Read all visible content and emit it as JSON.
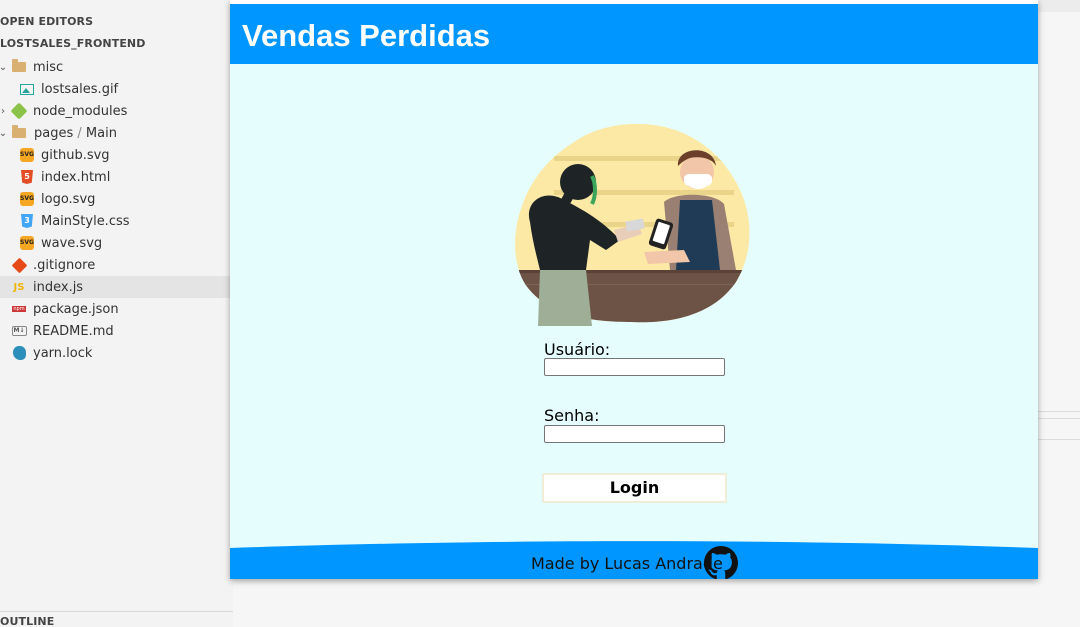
{
  "sidebar": {
    "open_editors_label": "OPEN EDITORS",
    "project_label": "LOSTSALES_FRONTEND",
    "outline_label": "OUTLINE",
    "tree": [
      {
        "label": "misc",
        "icon": "folder-icon"
      },
      {
        "label": "lostsales.gif",
        "icon": "image-icon"
      },
      {
        "label": "node_modules",
        "icon": "node-folder-icon"
      },
      {
        "label": "pages",
        "sep": " / ",
        "label2": "Main",
        "icon": "folder-icon"
      },
      {
        "label": "github.svg",
        "icon": "svg-icon"
      },
      {
        "label": "index.html",
        "icon": "html-icon"
      },
      {
        "label": "logo.svg",
        "icon": "svg-icon"
      },
      {
        "label": "MainStyle.css",
        "icon": "css-icon"
      },
      {
        "label": "wave.svg",
        "icon": "svg-icon"
      },
      {
        "label": ".gitignore",
        "icon": "git-icon"
      },
      {
        "label": "index.js",
        "icon": "js-icon"
      },
      {
        "label": "package.json",
        "icon": "npm-icon"
      },
      {
        "label": "README.md",
        "icon": "markdown-icon"
      },
      {
        "label": "yarn.lock",
        "icon": "yarn-icon"
      }
    ],
    "icon_text": {
      "js": "JS",
      "svg": "SVG",
      "html": "5",
      "css": "3",
      "md": "M↓",
      "npm": "npm"
    }
  },
  "app": {
    "title": "Vendas Perdidas",
    "user_label": "Usuário:",
    "user_value": "",
    "password_label": "Senha:",
    "password_value": "",
    "login_label": "Login",
    "footer_text": "Made by Lucas Andrade"
  },
  "colors": {
    "header_blue": "#0096ff",
    "app_background": "#e6fdfd",
    "sidebar_background": "#f3f3f3"
  }
}
